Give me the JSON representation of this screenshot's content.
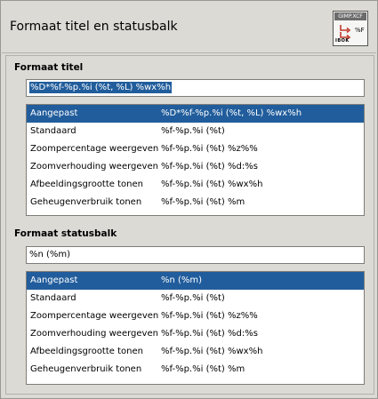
{
  "header": {
    "title": "Formaat titel en statusbalk",
    "icon_tag": "GIMP.XCF",
    "icon_percent": "%F",
    "icon_footer": "IBOK"
  },
  "title_format": {
    "label": "Formaat titel",
    "value": "%D*%f-%p.%i (%t, %L) %wx%h",
    "rows": [
      {
        "name": "Aangepast",
        "format": "%D*%f-%p.%i (%t, %L) %wx%h"
      },
      {
        "name": "Standaard",
        "format": "%f-%p.%i (%t)"
      },
      {
        "name": "Zoompercentage weergeven",
        "format": "%f-%p.%i (%t) %z%%"
      },
      {
        "name": "Zoomverhouding weergeven",
        "format": "%f-%p.%i (%t) %d:%s"
      },
      {
        "name": "Afbeeldingsgrootte tonen",
        "format": "%f-%p.%i (%t) %wx%h"
      },
      {
        "name": "Geheugenverbruik tonen",
        "format": "%f-%p.%i (%t) %m"
      }
    ]
  },
  "status_format": {
    "label": "Formaat statusbalk",
    "value": "%n (%m)",
    "rows": [
      {
        "name": "Aangepast",
        "format": "%n (%m)"
      },
      {
        "name": "Standaard",
        "format": "%f-%p.%i (%t)"
      },
      {
        "name": "Zoompercentage weergeven",
        "format": "%f-%p.%i (%t) %z%%"
      },
      {
        "name": "Zoomverhouding weergeven",
        "format": "%f-%p.%i (%t) %d:%s"
      },
      {
        "name": "Afbeeldingsgrootte tonen",
        "format": "%f-%p.%i (%t) %wx%h"
      },
      {
        "name": "Geheugenverbruik tonen",
        "format": "%f-%p.%i (%t) %m"
      }
    ]
  },
  "colors": {
    "selection": "#215d9c",
    "background": "#dcdad5"
  }
}
